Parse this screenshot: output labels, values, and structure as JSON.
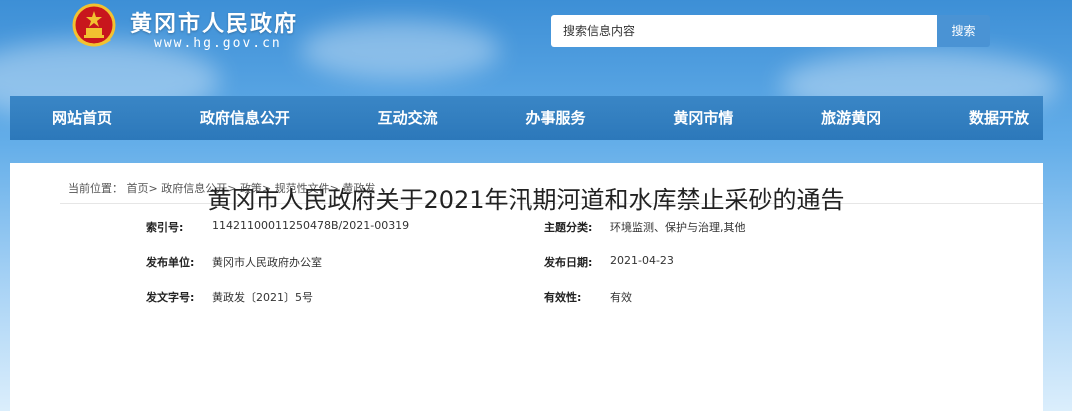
{
  "header": {
    "site_title": "黄冈市人民政府",
    "site_url": "www.hg.gov.cn",
    "emblem_icon": "national-emblem-icon"
  },
  "search": {
    "placeholder": "搜索信息内容",
    "button_label": "搜索"
  },
  "nav": {
    "items": [
      {
        "label": "网站首页"
      },
      {
        "label": "政府信息公开"
      },
      {
        "label": "互动交流"
      },
      {
        "label": "办事服务"
      },
      {
        "label": "黄冈市情"
      },
      {
        "label": "旅游黄冈"
      },
      {
        "label": "数据开放"
      }
    ]
  },
  "breadcrumb": {
    "prefix": "当前位置：",
    "items": [
      "首页",
      "政府信息公开",
      "政策",
      "规范性文件",
      "黄政发"
    ],
    "separator": ">"
  },
  "meta": {
    "index_label": "索引号:",
    "index_value": "11421100011250478B/2021-00319",
    "publisher_label": "发布单位:",
    "publisher_value": "黄冈市人民政府办公室",
    "docno_label": "发文字号:",
    "docno_value": "黄政发〔2021〕5号",
    "topic_label": "主题分类:",
    "topic_value": "环境监测、保护与治理,其他",
    "date_label": "发布日期:",
    "date_value": "2021-04-23",
    "validity_label": "有效性:",
    "validity_value": "有效"
  },
  "document": {
    "title": "黄冈市人民政府关于2021年汛期河道和水库禁止采砂的通告"
  },
  "colors": {
    "nav_bg": "#2c78ba",
    "search_button": "#4a93d4",
    "sky_top": "#3d8fd6",
    "emblem_red": "#c8161d",
    "emblem_gold": "#f2c230"
  }
}
